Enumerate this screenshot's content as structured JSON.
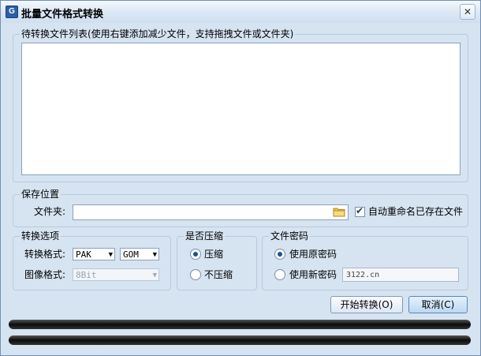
{
  "window": {
    "title": "批量文件格式转换",
    "close_glyph": "✕",
    "app_icon_letter": "G"
  },
  "file_list": {
    "legend": "待转换文件列表(使用右键添加减少文件，支持拖拽文件或文件夹)",
    "items": []
  },
  "save": {
    "legend": "保存位置",
    "folder_label": "文件夹:",
    "folder_value": "",
    "auto_rename_label": "自动重命名已存在文件",
    "auto_rename_checked": true
  },
  "convert": {
    "legend": "转换选项",
    "format_label": "转换格式:",
    "format_from": "PAK",
    "format_to": "GOM",
    "image_label": "图像格式:",
    "image_value": "8Bit"
  },
  "compress": {
    "legend": "是否压缩",
    "yes": "压缩",
    "no": "不压缩",
    "selected": "yes"
  },
  "password": {
    "legend": "文件密码",
    "original": "使用原密码",
    "new": "使用新密码",
    "new_value": "3122.cn",
    "selected": "original"
  },
  "buttons": {
    "start": "开始转换(O)",
    "cancel": "取消(C)"
  },
  "progress": [
    {
      "value": 1.0
    },
    {
      "value": 1.0
    }
  ],
  "colors": {
    "accent": "#1f4f93",
    "window_bg": "#d6e3f1",
    "progress": "#0c0c0c"
  }
}
